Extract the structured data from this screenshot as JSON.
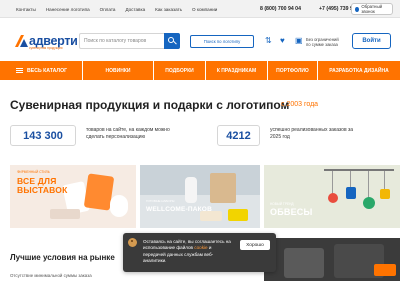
{
  "topbar": {
    "links": [
      "Контакты",
      "Нанесение логотипа",
      "Оплата",
      "Доставка",
      "Как заказать",
      "О компании"
    ],
    "phone1": "8 (800) 700 94 04",
    "phone2": "+7 (495) 739 90 80",
    "callback_label": "Обратный звонок"
  },
  "header": {
    "logo_name": "адверти",
    "logo_tagline": "сувенирная продукция",
    "search_placeholder": "Поиск по каталогу товаров",
    "logo_search_label": "Поиск по логотипу",
    "cart_note_1": "Без ограничений",
    "cart_note_2": "по сумме заказа",
    "login_label": "Войти"
  },
  "nav": {
    "catalog_label": "ВЕСЬ КАТАЛОГ",
    "items": [
      "НОВИНКИ",
      "ПОДБОРКИ",
      "К ПРАЗДНИКАМ",
      "ПОРТФОЛИО",
      "РАЗРАБОТКА ДИЗАЙНА"
    ]
  },
  "hero": {
    "title": "Сувенирная продукция и подарки с логотипом",
    "year": "с 2003 года"
  },
  "stats": [
    {
      "value": "143 300",
      "text": "товаров на сайте, на каждом можно сделать персонализацию"
    },
    {
      "value": "4212",
      "text": "успешно реализованных заказов за 2025 год"
    }
  ],
  "cards": [
    {
      "sub": "ФИРМЕННЫЙ СТИЛЬ",
      "line1": "ВСЕ ДЛЯ",
      "line2": "ВЫСТАВОК"
    },
    {
      "sub": "ГОТОВЫЕ НАБОРЫ",
      "line1": "WELLCOME-ПАКОВ",
      "line2": ""
    },
    {
      "sub": "НОВЫЙ ТРЕНД",
      "line1": "ОБВЕСЫ",
      "line2": ""
    }
  ],
  "lower": {
    "title": "Лучшие условия на рынке",
    "text": "Отсутствие минимальной суммы заказа"
  },
  "cookie": {
    "text_before": "Оставаясь на сайте, вы соглашаетесь на использование файлов",
    "link": "cookie",
    "text_after": "и передачей данных службам веб-аналитики.",
    "ok_label": "Хорошо"
  },
  "colors": {
    "accent": "#ff7300",
    "brand_blue": "#1565c0",
    "logo_blue": "#1a4fa1"
  }
}
